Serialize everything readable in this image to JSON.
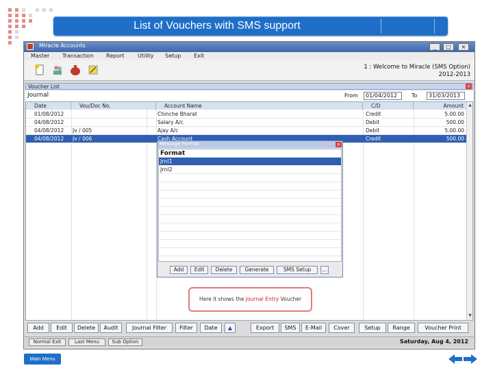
{
  "banner": {
    "title": "List of Vouchers with SMS support"
  },
  "window": {
    "title": "Miracle Accounts",
    "minimize": "_",
    "maximize": "□",
    "close": "×"
  },
  "menubar": [
    "Master",
    "Transaction",
    "Report",
    "Utility",
    "Setup",
    "Exit"
  ],
  "toolbar": {
    "welcome_line1": "1 : Welcome to Miracle (SMS Option)",
    "welcome_line2": "2012-2013"
  },
  "voucher_list": {
    "title": "Voucher List",
    "close": "×",
    "journal_label": "Journal",
    "from_label": "From",
    "from_value": "01/04/2012",
    "to_label": "To",
    "to_value": "31/03/2013",
    "columns": [
      "Date",
      "Vou/Doc No.",
      "Account Name",
      "C/D",
      "Amount"
    ],
    "rows": [
      {
        "date": "01/08/2012",
        "vou": "",
        "account": "Chinche Bharat",
        "cd": "Credit",
        "amount": "5.00.00"
      },
      {
        "date": "04/08/2012",
        "vou": "",
        "account": "Salary A/c",
        "cd": "Debit",
        "amount": "500.00"
      },
      {
        "date": "04/08/2012",
        "vou": "Jv / 005",
        "account": "Ajay A/c",
        "cd": "Debit",
        "amount": "5.00.00"
      },
      {
        "date": "04/08/2012",
        "vou": "Jv / 006",
        "account": "Cash Account",
        "cd": "Credit",
        "amount": "500.00"
      }
    ]
  },
  "message_format": {
    "title": "Message Format",
    "close": "×",
    "header": "Format",
    "items": [
      "Jrnl1",
      "Jrnl2"
    ],
    "buttons": [
      "Add",
      "Edit",
      "Delete",
      "Generate",
      "SMS Setup",
      "..."
    ]
  },
  "callout": {
    "prefix": "Here it shows the ",
    "highlight": "Journal Entry",
    "suffix": " Voucher"
  },
  "bottom_buttons": [
    "Add",
    "Edit",
    "Delete",
    "Audit",
    "Journal Filter",
    "Filter",
    "Date",
    "▲",
    "Export",
    "SMS",
    "E-Mail",
    "Cover",
    "Setup",
    "Range",
    "Voucher Print"
  ],
  "status_buttons": [
    "Normal Exit",
    "Last Menu",
    "Sub Option"
  ],
  "status_date": "Saturday, Aug 4, 2012",
  "main_menu": "Main Menu",
  "colors": {
    "banner": "#1f6fc8",
    "selection": "#2f5fb3",
    "callout_border": "#e07a7a"
  }
}
